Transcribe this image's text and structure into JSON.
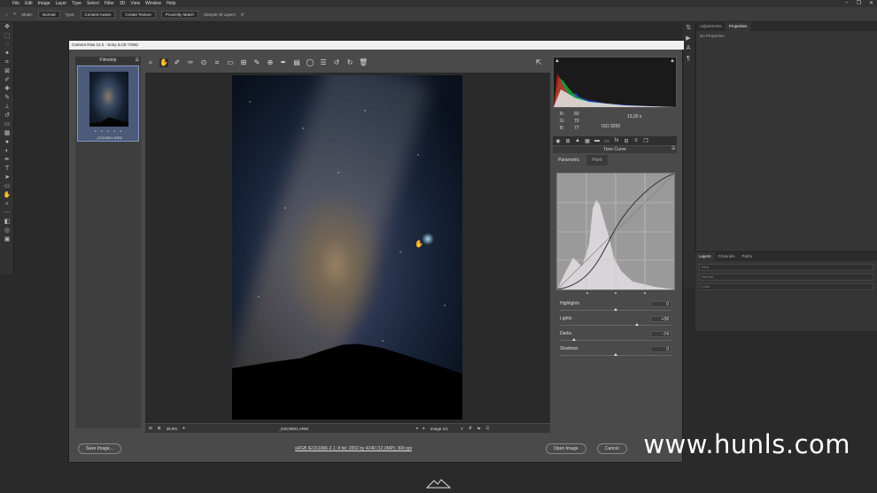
{
  "menubar": {
    "items": [
      "File",
      "Edit",
      "Image",
      "Layer",
      "Type",
      "Select",
      "Filter",
      "3D",
      "View",
      "Window",
      "Help"
    ]
  },
  "optionsbar": {
    "mode_label": "Mode:",
    "mode_value": "Normal",
    "type_label": "Type:",
    "type_options": [
      "Content-Aware",
      "Create Texture",
      "Proximity Match"
    ],
    "sample_label": "Sample All Layers",
    "angle": "0°"
  },
  "right_panel": {
    "tabs": [
      "Adjustments",
      "Properties"
    ],
    "no_props": "No Properties"
  },
  "layers_panel": {
    "tabs": [
      "Layers",
      "Channels",
      "Paths"
    ],
    "kind_label": "Kind",
    "mode_value": "Normal",
    "lock_label": "Lock:"
  },
  "dialog": {
    "title": "Camera Raw 12.2  -  Sony ILCE-7SM2",
    "filmstrip": {
      "header": "Filmstrip",
      "stars": "• • • • •",
      "filename": "_DSC8901.ARW"
    },
    "status": {
      "zoom": "35,8%",
      "filename": "_DSC8901.ARW",
      "image_count": "Image 1/1"
    },
    "readout": {
      "r_label": "R:",
      "r": "60",
      "g_label": "G:",
      "g": "70",
      "b_label": "B:",
      "b": "77",
      "shutter": "13,00 s",
      "iso": "ISO 3200"
    },
    "tone_curve": {
      "title": "Tone Curve",
      "tabs": [
        "Parametric",
        "Point"
      ]
    },
    "sliders": [
      {
        "label": "Highlights",
        "value": "0",
        "pos": 0.5
      },
      {
        "label": "Lights",
        "value": "+38",
        "pos": 0.69
      },
      {
        "label": "Darks",
        "value": "-74",
        "pos": 0.13
      },
      {
        "label": "Shadows",
        "value": "0",
        "pos": 0.5
      }
    ],
    "buttons": {
      "save": "Save Image...",
      "open": "Open Image",
      "cancel": "Cancel"
    },
    "info_link": "sRGB IEC61966-2.1; 8 bit; 2832 by 4240 (12,0MP); 300 ppi"
  },
  "watermark": "www.hunls.com",
  "colors": {
    "accent": "#7f95c4"
  }
}
